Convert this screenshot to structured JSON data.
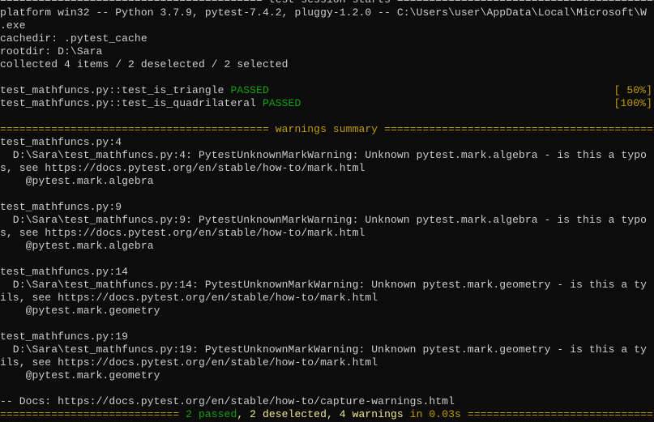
{
  "window": {
    "type": "terminal",
    "background": "#0c0c0c",
    "foreground": "#cccccc"
  },
  "colors": {
    "green": "#13a10e",
    "yellow": "#c19c00",
    "bright_yellow": "#f0e68c"
  },
  "lines": [
    {
      "segments": [
        {
          "text": "========================================= test session starts ==============================================",
          "color": "default"
        }
      ]
    },
    {
      "segments": [
        {
          "text": "platform win32 -- Python 3.7.9, pytest-7.4.2, pluggy-1.2.0 -- C:\\Users\\user\\AppData\\Local\\Microsoft\\W",
          "color": "default"
        }
      ]
    },
    {
      "segments": [
        {
          "text": ".exe",
          "color": "default"
        }
      ]
    },
    {
      "segments": [
        {
          "text": "cachedir: .pytest_cache",
          "color": "default"
        }
      ]
    },
    {
      "segments": [
        {
          "text": "rootdir: D:\\Sara",
          "color": "default"
        }
      ]
    },
    {
      "segments": [
        {
          "text": "collected 4 items / 2 deselected / 2 selected",
          "color": "default"
        }
      ]
    },
    {
      "segments": []
    },
    {
      "segments": [
        {
          "text": "test_mathfuncs.py::test_is_triangle ",
          "color": "default"
        },
        {
          "text": "PASSED",
          "color": "green"
        }
      ],
      "right": {
        "text": "[ 50%]",
        "color": "yellow"
      }
    },
    {
      "segments": [
        {
          "text": "test_mathfuncs.py::test_is_quadrilateral ",
          "color": "default"
        },
        {
          "text": "PASSED",
          "color": "green"
        }
      ],
      "right": {
        "text": "[100%]",
        "color": "yellow"
      }
    },
    {
      "segments": []
    },
    {
      "segments": [
        {
          "text": "========================================== warnings summary ==============================================",
          "color": "yellow"
        }
      ]
    },
    {
      "segments": [
        {
          "text": "test_mathfuncs.py:4",
          "color": "default"
        }
      ]
    },
    {
      "segments": [
        {
          "text": "  D:\\Sara\\test_mathfuncs.py:4: PytestUnknownMarkWarning: Unknown pytest.mark.algebra - is this a typo",
          "color": "default"
        }
      ]
    },
    {
      "segments": [
        {
          "text": "s, see https://docs.pytest.org/en/stable/how-to/mark.html",
          "color": "default"
        }
      ]
    },
    {
      "segments": [
        {
          "text": "    @pytest.mark.algebra",
          "color": "default"
        }
      ]
    },
    {
      "segments": []
    },
    {
      "segments": [
        {
          "text": "test_mathfuncs.py:9",
          "color": "default"
        }
      ]
    },
    {
      "segments": [
        {
          "text": "  D:\\Sara\\test_mathfuncs.py:9: PytestUnknownMarkWarning: Unknown pytest.mark.algebra - is this a typo",
          "color": "default"
        }
      ]
    },
    {
      "segments": [
        {
          "text": "s, see https://docs.pytest.org/en/stable/how-to/mark.html",
          "color": "default"
        }
      ]
    },
    {
      "segments": [
        {
          "text": "    @pytest.mark.algebra",
          "color": "default"
        }
      ]
    },
    {
      "segments": []
    },
    {
      "segments": [
        {
          "text": "test_mathfuncs.py:14",
          "color": "default"
        }
      ]
    },
    {
      "segments": [
        {
          "text": "  D:\\Sara\\test_mathfuncs.py:14: PytestUnknownMarkWarning: Unknown pytest.mark.geometry - is this a ty",
          "color": "default"
        }
      ]
    },
    {
      "segments": [
        {
          "text": "ils, see https://docs.pytest.org/en/stable/how-to/mark.html",
          "color": "default"
        }
      ]
    },
    {
      "segments": [
        {
          "text": "    @pytest.mark.geometry",
          "color": "default"
        }
      ]
    },
    {
      "segments": []
    },
    {
      "segments": [
        {
          "text": "test_mathfuncs.py:19",
          "color": "default"
        }
      ]
    },
    {
      "segments": [
        {
          "text": "  D:\\Sara\\test_mathfuncs.py:19: PytestUnknownMarkWarning: Unknown pytest.mark.geometry - is this a ty",
          "color": "default"
        }
      ]
    },
    {
      "segments": [
        {
          "text": "ils, see https://docs.pytest.org/en/stable/how-to/mark.html",
          "color": "default"
        }
      ]
    },
    {
      "segments": [
        {
          "text": "    @pytest.mark.geometry",
          "color": "default"
        }
      ]
    },
    {
      "segments": []
    },
    {
      "segments": [
        {
          "text": "-- Docs: https://docs.pytest.org/en/stable/how-to/capture-warnings.html",
          "color": "default"
        }
      ]
    },
    {
      "segments": [
        {
          "text": "============================ ",
          "color": "yellow"
        },
        {
          "text": "2 passed",
          "color": "green"
        },
        {
          "text": ", 2 deselected, 4 warnings ",
          "color": "bright_yellow"
        },
        {
          "text": "in 0.03s",
          "color": "yellow"
        },
        {
          "text": " ==================================================",
          "color": "yellow"
        }
      ]
    }
  ]
}
